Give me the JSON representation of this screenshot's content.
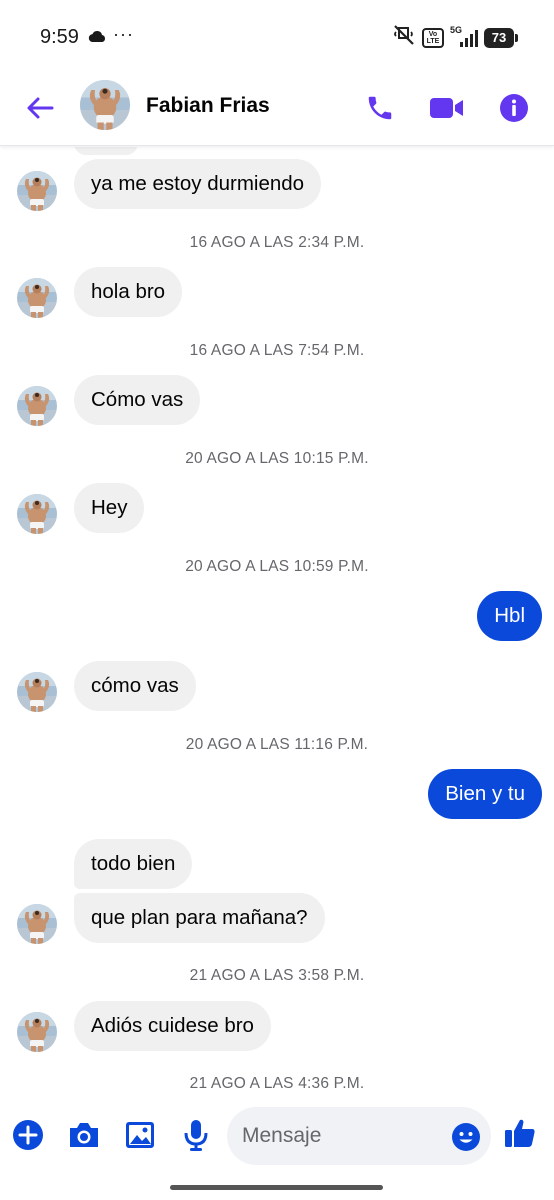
{
  "status_bar": {
    "time": "9:59",
    "overflow": "···",
    "network": "5G",
    "volte_top": "Vo",
    "volte_bottom": "LTE",
    "battery": "73"
  },
  "header": {
    "contact_name": "Fabian Frias",
    "icons": [
      "back-arrow-icon",
      "phone-icon",
      "video-camera-icon",
      "info-icon"
    ],
    "accent_color": "#6336f0"
  },
  "messages": [
    {
      "type": "incoming",
      "text": "ya me estoy durmiendo"
    },
    {
      "type": "timestamp",
      "text": "16 AGO A LAS 2:34 P.M."
    },
    {
      "type": "incoming",
      "text": "hola bro"
    },
    {
      "type": "timestamp",
      "text": "16 AGO A LAS 7:54 P.M."
    },
    {
      "type": "incoming",
      "text": "Cómo vas"
    },
    {
      "type": "timestamp",
      "text": "20 AGO A LAS 10:15 P.M."
    },
    {
      "type": "incoming",
      "text": "Hey"
    },
    {
      "type": "timestamp",
      "text": "20 AGO A LAS 10:59 P.M."
    },
    {
      "type": "outgoing",
      "text": "Hbl"
    },
    {
      "type": "incoming",
      "text": "cómo vas"
    },
    {
      "type": "timestamp",
      "text": "20 AGO A LAS 11:16 P.M."
    },
    {
      "type": "outgoing",
      "text": "Bien y tu"
    },
    {
      "type": "incoming",
      "text": "todo bien"
    },
    {
      "type": "incoming",
      "text": "que plan para mañana?"
    },
    {
      "type": "timestamp",
      "text": "21 AGO A LAS 3:58 P.M."
    },
    {
      "type": "incoming",
      "text": "Adiós cuidese bro"
    },
    {
      "type": "timestamp",
      "text": "21 AGO A LAS 4:36 P.M."
    }
  ],
  "composer": {
    "placeholder": "Mensaje",
    "icons": [
      "plus-icon",
      "camera-icon",
      "image-icon",
      "microphone-icon",
      "emoji-icon",
      "thumbs-up-icon"
    ]
  },
  "colors": {
    "outgoing_bubble": "#0a49d9",
    "incoming_bubble": "#f0f0f0",
    "timestamp_text": "#65676b",
    "accent": "#6336f0",
    "composer_icons": "#0a49d9"
  }
}
